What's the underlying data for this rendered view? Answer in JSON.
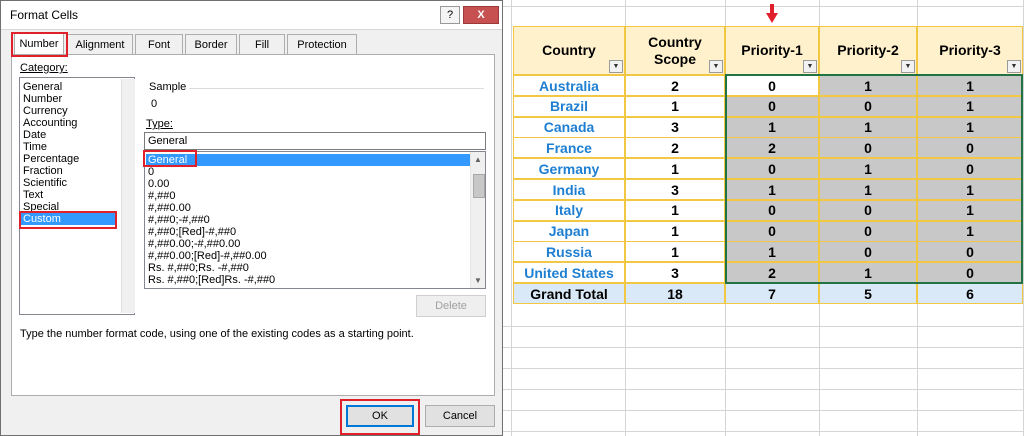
{
  "dialog": {
    "title": "Format Cells",
    "help_label": "?",
    "close_label": "X",
    "tabs": [
      {
        "label": "Number"
      },
      {
        "label": "Alignment"
      },
      {
        "label": "Font"
      },
      {
        "label": "Border"
      },
      {
        "label": "Fill"
      },
      {
        "label": "Protection"
      }
    ],
    "active_tab": "Number",
    "category_label": "Category:",
    "categories": [
      "General",
      "Number",
      "Currency",
      "Accounting",
      "Date",
      "Time",
      "Percentage",
      "Fraction",
      "Scientific",
      "Text",
      "Special",
      "Custom"
    ],
    "selected_category": "Custom",
    "sample_label": "Sample",
    "sample_value": "0",
    "type_label": "Type:",
    "type_value": "General",
    "type_items": [
      "General",
      "0",
      "0.00",
      "#,##0",
      "#,##0.00",
      "#,##0;-#,##0",
      "#,##0;[Red]-#,##0",
      "#,##0.00;-#,##0.00",
      "#,##0.00;[Red]-#,##0.00",
      "Rs. #,##0;Rs. -#,##0",
      "Rs. #,##0;[Red]Rs. -#,##0"
    ],
    "selected_type": "General",
    "delete_label": "Delete",
    "hint": "Type the number format code, using one of the existing codes as a starting point.",
    "ok_label": "OK",
    "cancel_label": "Cancel",
    "highlight_color": "#e0202a",
    "selection_color": "#3399ff"
  },
  "sheet": {
    "headers": [
      {
        "label": "Country",
        "filter": true
      },
      {
        "label": "Country\nScope",
        "filter": true
      },
      {
        "label": "Priority-1",
        "filter": true
      },
      {
        "label": "Priority-2",
        "filter": true
      },
      {
        "label": "Priority-3",
        "filter": true
      }
    ],
    "rows": [
      {
        "country": "Australia",
        "scope": "2",
        "p1": "0",
        "p2": "1",
        "p3": "1"
      },
      {
        "country": "Brazil",
        "scope": "1",
        "p1": "0",
        "p2": "0",
        "p3": "1"
      },
      {
        "country": "Canada",
        "scope": "3",
        "p1": "1",
        "p2": "1",
        "p3": "1"
      },
      {
        "country": "France",
        "scope": "2",
        "p1": "2",
        "p2": "0",
        "p3": "0"
      },
      {
        "country": "Germany",
        "scope": "1",
        "p1": "0",
        "p2": "1",
        "p3": "0"
      },
      {
        "country": "India",
        "scope": "3",
        "p1": "1",
        "p2": "1",
        "p3": "1"
      },
      {
        "country": "Italy",
        "scope": "1",
        "p1": "0",
        "p2": "0",
        "p3": "1"
      },
      {
        "country": "Japan",
        "scope": "1",
        "p1": "0",
        "p2": "0",
        "p3": "1"
      },
      {
        "country": "Russia",
        "scope": "1",
        "p1": "1",
        "p2": "0",
        "p3": "0"
      },
      {
        "country": "United States",
        "scope": "3",
        "p1": "2",
        "p2": "1",
        "p3": "0"
      }
    ],
    "total": {
      "label": "Grand Total",
      "scope": "18",
      "p1": "7",
      "p2": "5",
      "p3": "6"
    },
    "header_fill": "#fff1cc",
    "total_fill": "#dae9f7",
    "selected_fill": "#c8c8c8",
    "country_color": "#1e7fd2",
    "arrow_color": "#e0202a",
    "filter_icon": "dropdown-arrow-icon"
  }
}
